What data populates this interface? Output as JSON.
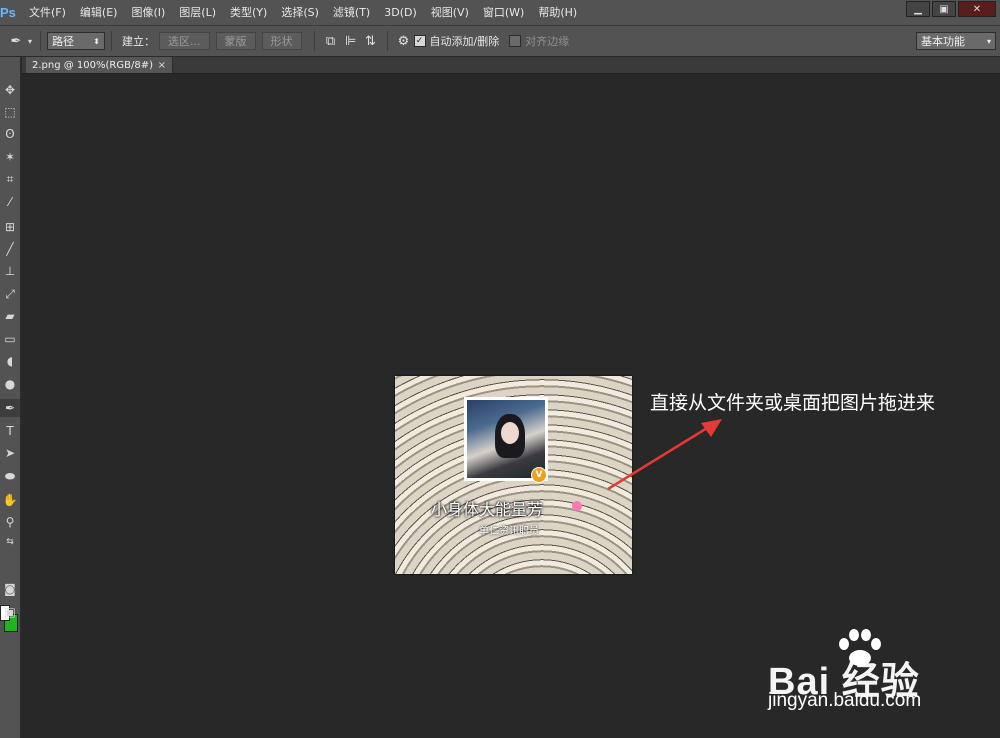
{
  "app": {
    "logo_text": "Ps"
  },
  "menu": [
    "文件(F)",
    "编辑(E)",
    "图像(I)",
    "图层(L)",
    "类型(Y)",
    "选择(S)",
    "滤镜(T)",
    "3D(D)",
    "视图(V)",
    "窗口(W)",
    "帮助(H)"
  ],
  "window_controls": {
    "minimize": "▁",
    "restore": "▣",
    "close": "✕"
  },
  "options_bar": {
    "mode_value": "路径",
    "build_label": "建立：",
    "buttons": [
      "选区...",
      "蒙版",
      "形状"
    ],
    "auto_add_delete_label": "自动添加/删除",
    "auto_add_delete_checked": true,
    "align_edges_label": "对齐边缘",
    "align_edges_checked": false,
    "workspace_value": "基本功能"
  },
  "document_tab": {
    "title": "2.png @ 100%(RGB/8#)",
    "close": "×"
  },
  "toolbar": {
    "tools": [
      "move-tool",
      "marquee-tool",
      "lasso-tool",
      "magic-wand-tool",
      "crop-tool",
      "eyedropper-tool",
      "healing-brush-tool",
      "brush-tool",
      "clone-stamp-tool",
      "history-brush-tool",
      "eraser-tool",
      "gradient-tool",
      "blur-tool",
      "dodge-tool",
      "pen-tool",
      "type-tool",
      "path-selection-tool",
      "shape-tool",
      "hand-tool",
      "zoom-tool"
    ],
    "active_tool": "pen-tool",
    "foreground_color": "#ffffff",
    "background_color": "#1fb51f"
  },
  "canvas": {
    "profile_name": "小身体大能量芳",
    "profile_subtitle": "单仁资讯职员",
    "verified_badge": "V"
  },
  "annotation": {
    "text": "直接从文件夹或桌面把图片拖进来",
    "arrow_color": "#e53935"
  },
  "watermark": {
    "brand": "Bai 经验",
    "url": "jingyan.baidu.com"
  }
}
